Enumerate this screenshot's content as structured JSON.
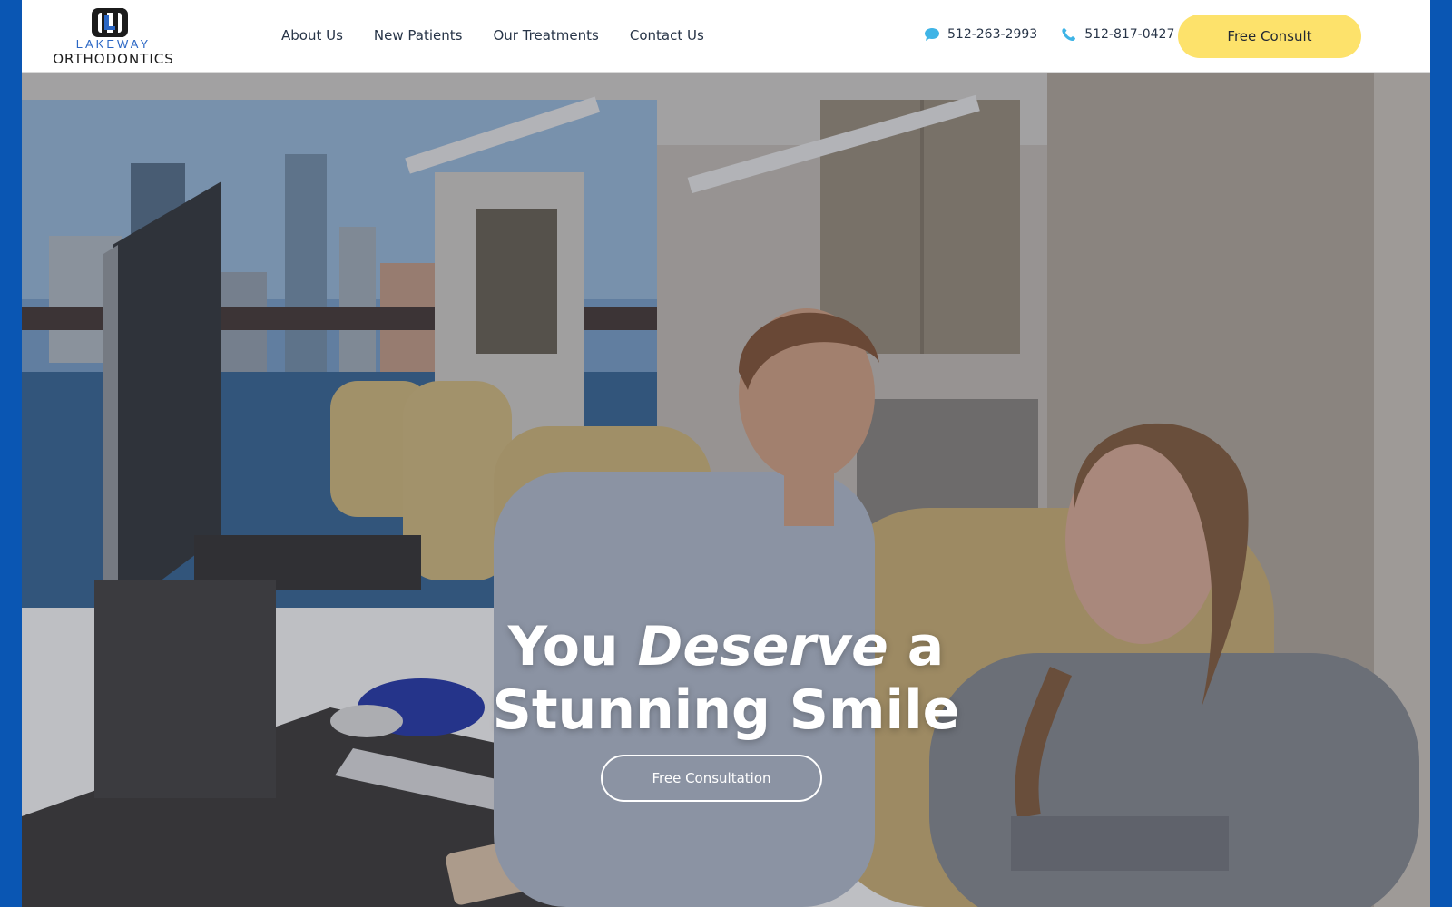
{
  "logo": {
    "line1": "LAKEWAY",
    "line2": "ORTHODONTICS"
  },
  "nav": [
    {
      "label": "About Us"
    },
    {
      "label": "New Patients"
    },
    {
      "label": "Our Treatments"
    },
    {
      "label": "Contact Us"
    }
  ],
  "phones": {
    "text": {
      "number": "512-263-2993",
      "icon": "chat-bubble-icon"
    },
    "call": {
      "number": "512-817-0427",
      "icon": "phone-icon"
    }
  },
  "header_cta": {
    "label": "Free Consult"
  },
  "hero": {
    "title_before": "You ",
    "title_emphasis": "Deserve",
    "title_after": " a Stunning Smile",
    "button_label": "Free Consultation"
  },
  "colors": {
    "frame_blue": "#0a56b3",
    "cta_yellow": "#fde26b",
    "icon_cyan": "#3fb4e6",
    "nav_text": "#283548"
  }
}
